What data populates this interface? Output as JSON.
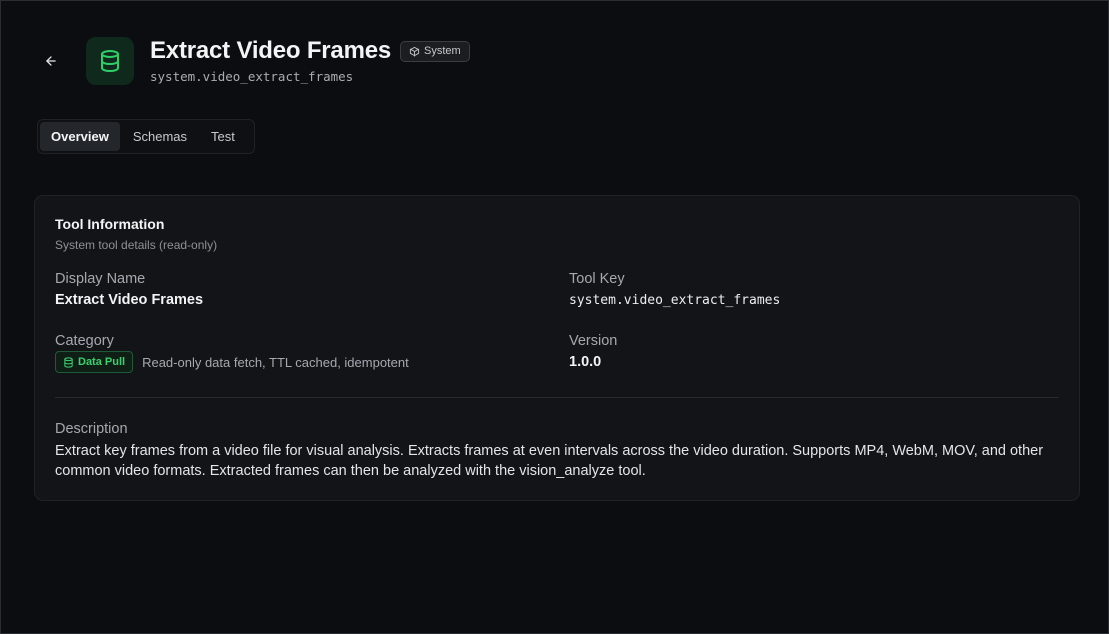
{
  "header": {
    "title": "Extract Video Frames",
    "badge": "System",
    "key": "system.video_extract_frames"
  },
  "tabs": [
    {
      "label": "Overview",
      "active": true
    },
    {
      "label": "Schemas",
      "active": false
    },
    {
      "label": "Test",
      "active": false
    }
  ],
  "card": {
    "title": "Tool Information",
    "subtitle": "System tool details (read-only)",
    "display_name_label": "Display Name",
    "display_name_value": "Extract Video Frames",
    "tool_key_label": "Tool Key",
    "tool_key_value": "system.video_extract_frames",
    "category_label": "Category",
    "category_badge": "Data Pull",
    "category_desc": "Read-only data fetch, TTL cached, idempotent",
    "version_label": "Version",
    "version_value": "1.0.0",
    "description_label": "Description",
    "description_value": "Extract key frames from a video file for visual analysis. Extracts frames at even intervals across the video duration. Supports MP4, WebM, MOV, and other common video formats. Extracted frames can then be analyzed with the vision_analyze tool."
  },
  "colors": {
    "accent_green": "#3bd16f",
    "background": "#0c0d10",
    "card": "#121418"
  },
  "icons": {
    "back": "arrow-left-icon",
    "tool": "database-icon",
    "system": "package-icon",
    "category": "database-icon"
  }
}
